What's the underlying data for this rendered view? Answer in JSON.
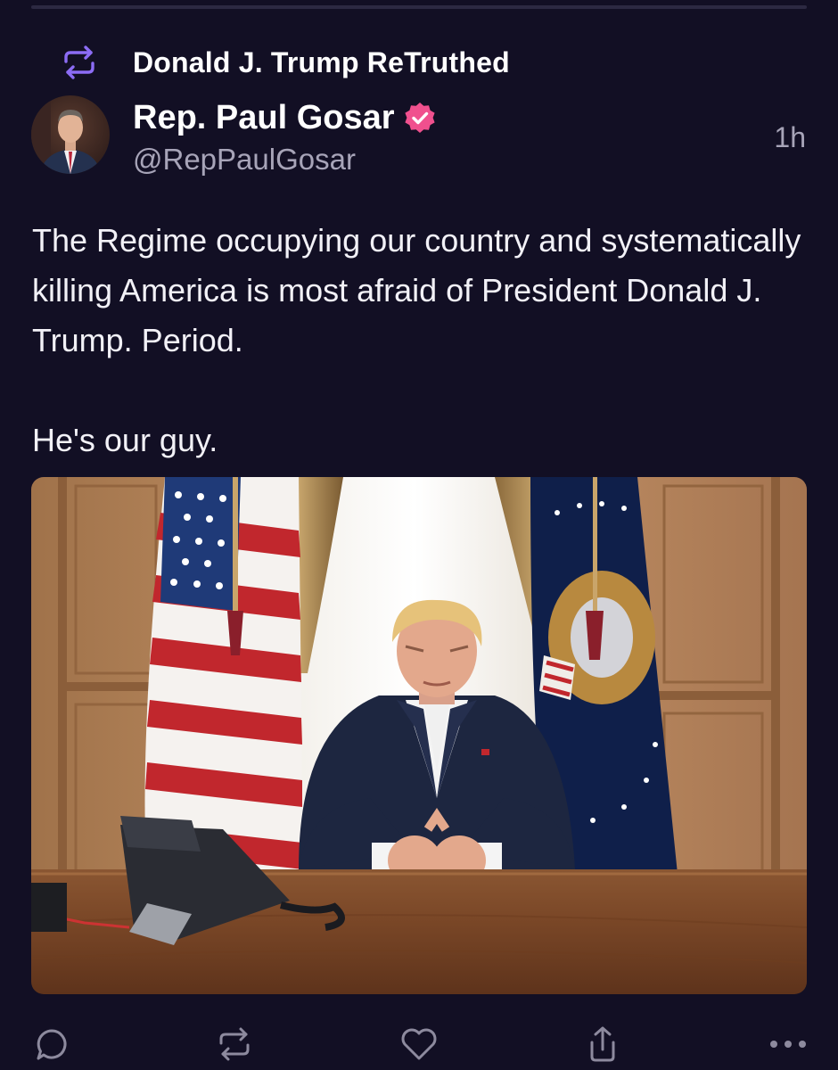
{
  "retruth": {
    "label": "Donald J. Trump ReTruthed",
    "icon": "retruth-icon"
  },
  "author": {
    "display_name": "Rep. Paul Gosar",
    "handle": "@RepPaulGosar",
    "verified_icon": "verified-badge-icon",
    "avatar_icon": "avatar"
  },
  "post": {
    "timestamp": "1h",
    "paragraphs": [
      "The Regime occupying our country and systematically killing America is most afraid of President Donald J. Trump. Period.",
      "He's our guy."
    ],
    "media": "photo"
  },
  "actions": {
    "reply_icon": "reply-icon",
    "retruth_icon": "retruth-icon",
    "like_icon": "heart-icon",
    "share_icon": "share-icon",
    "more_icon": "more-icon"
  },
  "colors": {
    "background": "#120f24",
    "accent": "#8c6cf5",
    "verified": "#f0508e",
    "muted_text": "#a7a4b8",
    "icon_gray": "#8d8a9e"
  }
}
